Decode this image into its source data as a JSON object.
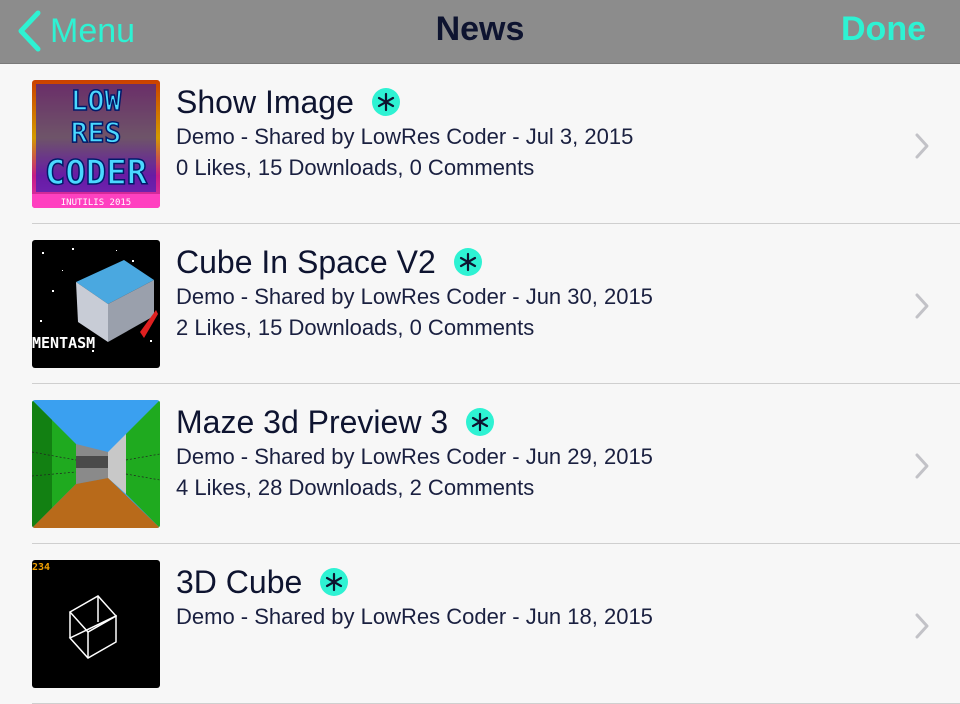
{
  "navbar": {
    "back_label": "Menu",
    "title": "News",
    "done_label": "Done"
  },
  "colors": {
    "accent": "#2ef2d3",
    "navbar_bg": "#8c8c8c",
    "text_dark": "#0e1430"
  },
  "items": [
    {
      "title": "Show Image",
      "meta": "Demo - Shared by LowRes Coder - Jul 3, 2015",
      "stats": "0 Likes, 15 Downloads, 0 Comments",
      "thumb_logo_text": "LOW RES CODER",
      "thumb_caption": "INUTILIS 2015"
    },
    {
      "title": "Cube In Space V2",
      "meta": "Demo - Shared by LowRes Coder - Jun 30, 2015",
      "stats": "2 Likes, 15 Downloads, 0 Comments",
      "thumb_caption": "MENTASM"
    },
    {
      "title": "Maze 3d Preview 3",
      "meta": "Demo - Shared by LowRes Coder - Jun 29, 2015",
      "stats": "4 Likes, 28 Downloads, 2 Comments"
    },
    {
      "title": "3D Cube",
      "meta": "Demo - Shared by LowRes Coder - Jun 18, 2015",
      "stats": "",
      "thumb_caption": "234"
    }
  ]
}
